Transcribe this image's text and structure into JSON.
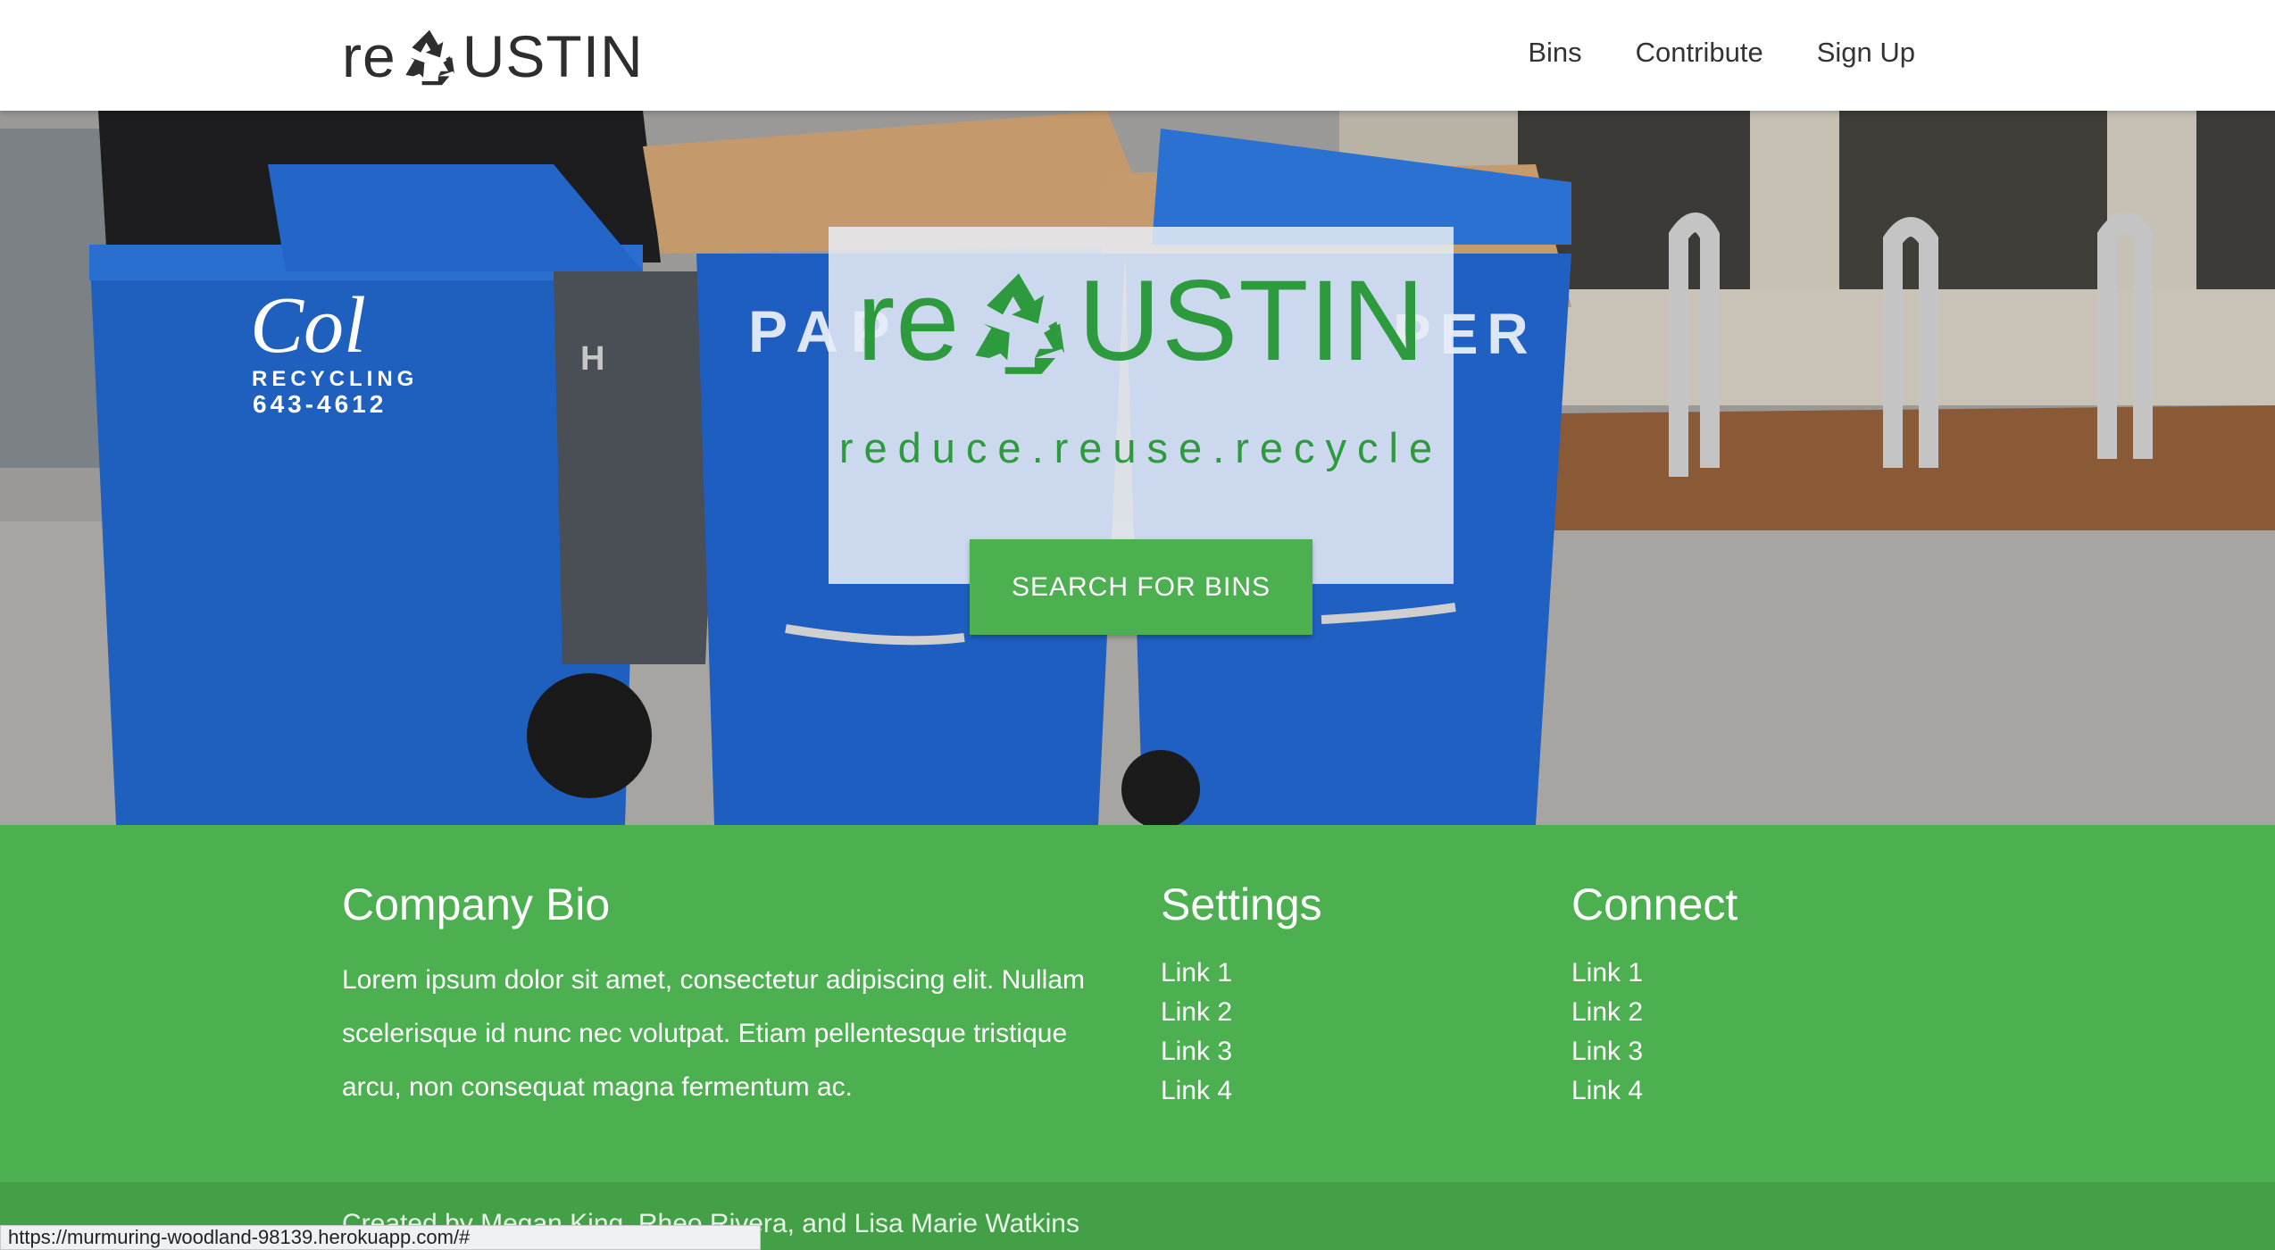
{
  "brand": {
    "prefix": "re",
    "suffix": "USTIN",
    "icon": "recycle-icon"
  },
  "nav": {
    "items": [
      {
        "label": "Bins"
      },
      {
        "label": "Contribute"
      },
      {
        "label": "Sign Up"
      }
    ]
  },
  "hero": {
    "title_prefix": "re",
    "title_suffix": "USTIN",
    "tagline": "reduce.reuse.recycle",
    "search_button": "SEARCH FOR BINS",
    "bin_text": {
      "brand": "Col",
      "company": "RECYCLING",
      "phone": "643-4612",
      "paper_left": "PAP",
      "paper_right": "PER",
      "side": "H"
    }
  },
  "footer": {
    "bio": {
      "heading": "Company Bio",
      "text": "Lorem ipsum dolor sit amet, consectetur adipiscing elit. Nullam scelerisque id nunc nec volutpat. Etiam pellentesque tristique arcu, non consequat magna fermentum ac."
    },
    "settings": {
      "heading": "Settings",
      "links": [
        "Link 1",
        "Link 2",
        "Link 3",
        "Link 4"
      ]
    },
    "connect": {
      "heading": "Connect",
      "links": [
        "Link 1",
        "Link 2",
        "Link 3",
        "Link 4"
      ]
    },
    "copyright": "Created by Megan King, Rheo Rivera, and Lisa Marie Watkins"
  },
  "status_bar": {
    "url": "https://murmuring-woodland-98139.herokuapp.com/#"
  },
  "colors": {
    "brand_green": "#2e9a3e",
    "footer_green": "#4caf50",
    "bin_blue": "#1f5fbd"
  }
}
